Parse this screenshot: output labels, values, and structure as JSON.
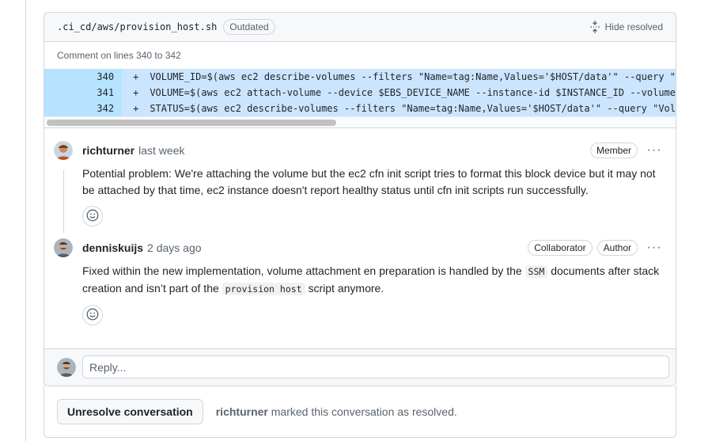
{
  "file": {
    "path": ".ci_cd/aws/provision_host.sh",
    "badge": "Outdated",
    "hide_resolved_label": "Hide resolved",
    "comment_range": "Comment on lines 340 to 342"
  },
  "code_lines": [
    {
      "num": "340",
      "sign": "+",
      "text": "VOLUME_ID=$(aws ec2 describe-volumes --filters \"Name=tag:Name,Values='$HOST/data'\" --query \""
    },
    {
      "num": "341",
      "sign": "+",
      "text": "VOLUME=$(aws ec2 attach-volume --device $EBS_DEVICE_NAME --instance-id $INSTANCE_ID --volume"
    },
    {
      "num": "342",
      "sign": "+",
      "text": "STATUS=$(aws ec2 describe-volumes --filters \"Name=tag:Name,Values='$HOST/data'\" --query \"Vol"
    }
  ],
  "comments": [
    {
      "author": "richturner",
      "time": "last week",
      "badges": [
        "Member"
      ],
      "body": "Potential problem: We're attaching the volume but the ec2 cfn init script tries to format this block device but it may not be attached by that time, ec2 instance doesn't report healthy status until cfn init scripts run successfully."
    },
    {
      "author": "denniskuijs",
      "time": "2 days ago",
      "badges": [
        "Collaborator",
        "Author"
      ],
      "body_parts": {
        "p1": "Fixed within the new implementation, volume attachment en preparation is handled by the ",
        "code1": "SSM",
        "p2": " documents after stack creation and isn’t part of the ",
        "code2": "provision host",
        "p3": " script anymore."
      }
    }
  ],
  "reply": {
    "placeholder": "Reply..."
  },
  "footer": {
    "button_label": "Unresolve conversation",
    "resolved_by": "richturner",
    "resolved_text": " marked this conversation as resolved."
  },
  "more_label": "···",
  "colors": {
    "code_bg": "#cce5ff",
    "line_num_bg": "#b6e3ff",
    "border": "#d0d7de",
    "muted": "#59636e"
  }
}
